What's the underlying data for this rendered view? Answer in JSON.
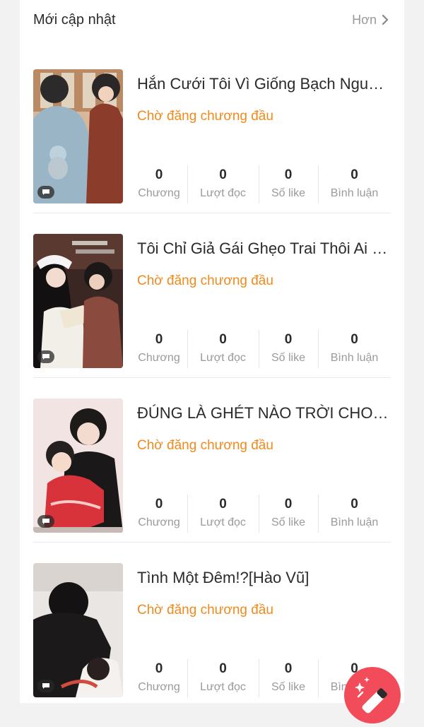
{
  "header": {
    "title": "Mới cập nhật",
    "more_label": "Hơn"
  },
  "stat_labels": [
    "Chương",
    "Lượt đọc",
    "Số like",
    "Bình luận"
  ],
  "books": [
    {
      "title": "Hắn Cưới Tôi Vì Giống Bạch Nguyệt Quang",
      "status": "Chờ đăng chương đầu",
      "stats": [
        "0",
        "0",
        "0",
        "0"
      ],
      "labels": [
        "Chương",
        "Lượt đọc",
        "Số like",
        "Bình luận"
      ]
    },
    {
      "title": "Tôi Chỉ Giả Gái Ghẹo Trai Thôi Ai Ngờ",
      "status": "Chờ đăng chương đầu",
      "stats": [
        "0",
        "0",
        "0",
        "0"
      ],
      "labels": [
        "Chương",
        "Lượt đọc",
        "Số like",
        "Bình luận"
      ]
    },
    {
      "title": "ĐÚNG LÀ GHÉT NÀO TRỜI CHO NẤY",
      "status": "Chờ đăng chương đầu",
      "stats": [
        "0",
        "0",
        "0",
        "0"
      ],
      "labels": [
        "Chương",
        "Lượt đọc",
        "Số like",
        "Bình luận"
      ]
    },
    {
      "title": "Tình Một Đêm!?[Hào Vũ]",
      "status": "Chờ đăng chương đầu",
      "stats": [
        "0",
        "0",
        "0",
        "0"
      ],
      "labels": [
        "Chương",
        "Lượt đọc",
        "Số like",
        "Bình luận"
      ]
    }
  ],
  "icons": {
    "more": "chevron-right-icon",
    "badge": "chat-bubble-icon",
    "fab": "magic-wand-icon"
  },
  "colors": {
    "accent": "#f08a1c",
    "fab": "#f24b5a",
    "page_bg": "#f2f2f2"
  }
}
